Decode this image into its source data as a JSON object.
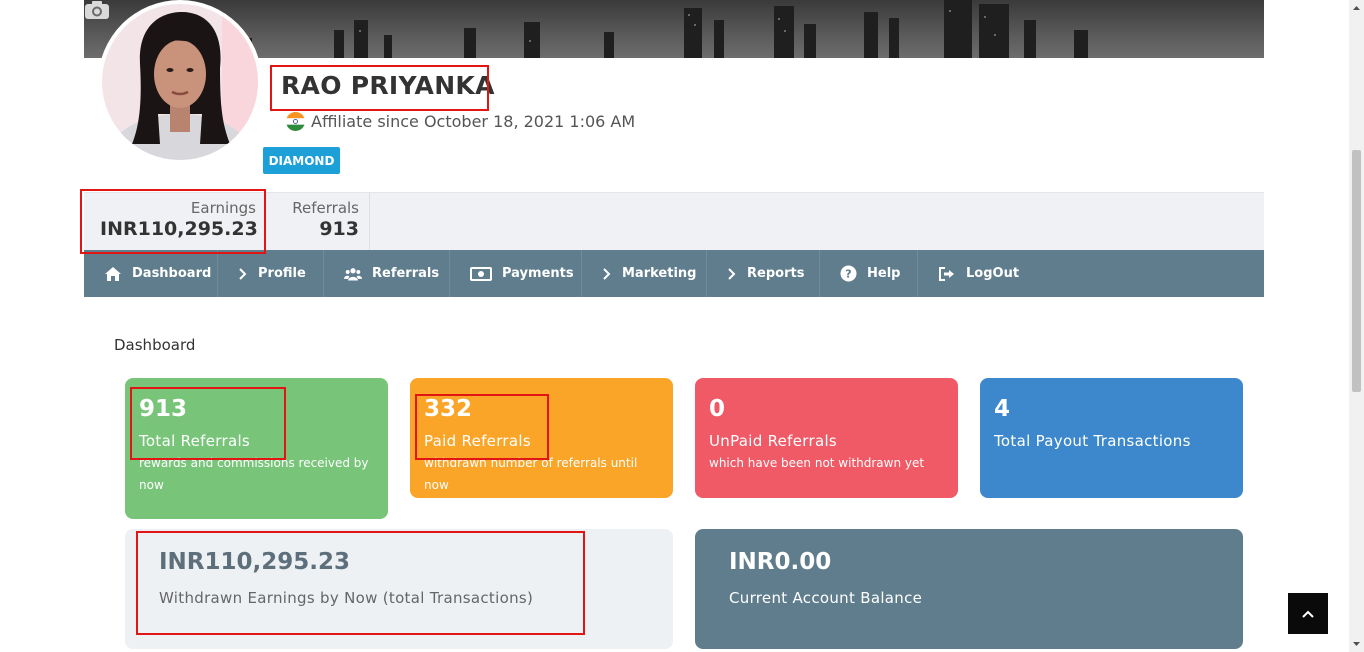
{
  "profile": {
    "name": "RAO PRIYANKA",
    "affiliate_since": "Affiliate since October 18, 2021 1:06 AM",
    "tier_badge": "DIAMOND",
    "country_flag_icon": "india-flag-icon"
  },
  "stats": {
    "earnings_label": "Earnings",
    "earnings_value": "INR110,295.23",
    "referrals_label": "Referrals",
    "referrals_value": "913"
  },
  "nav": {
    "items": [
      {
        "label": "Dashboard",
        "icon": "home-icon"
      },
      {
        "label": "Profile",
        "icon": "chevron-right-icon"
      },
      {
        "label": "Referrals",
        "icon": "users-icon"
      },
      {
        "label": "Payments",
        "icon": "money-icon"
      },
      {
        "label": "Marketing",
        "icon": "chevron-right-icon"
      },
      {
        "label": "Reports",
        "icon": "chevron-right-icon"
      },
      {
        "label": "Help",
        "icon": "question-circle-icon"
      },
      {
        "label": "LogOut",
        "icon": "sign-out-icon"
      }
    ]
  },
  "dashboard": {
    "title": "Dashboard",
    "cards": [
      {
        "value": "913",
        "title": "Total Referrals",
        "subtitle": "rewards and commissions received by now",
        "color": "#78c57a"
      },
      {
        "value": "332",
        "title": "Paid Referrals",
        "subtitle": "withdrawn number of referrals until now",
        "color": "#faa528"
      },
      {
        "value": "0",
        "title": "UnPaid Referrals",
        "subtitle": "which have been not withdrawn yet",
        "color": "#f05a66"
      },
      {
        "value": "4",
        "title": "Total Payout Transactions",
        "subtitle": "",
        "color": "#3d88cc"
      }
    ],
    "withdrawn": {
      "value": "INR110,295.23",
      "title": "Withdrawn Earnings by Now (total Transactions)"
    },
    "balance": {
      "value": "INR0.00",
      "title": "Current Account Balance"
    }
  },
  "colors": {
    "nav_bg": "#5f7d8c",
    "badge": "#1d9fd8",
    "highlight": "#e31414"
  }
}
